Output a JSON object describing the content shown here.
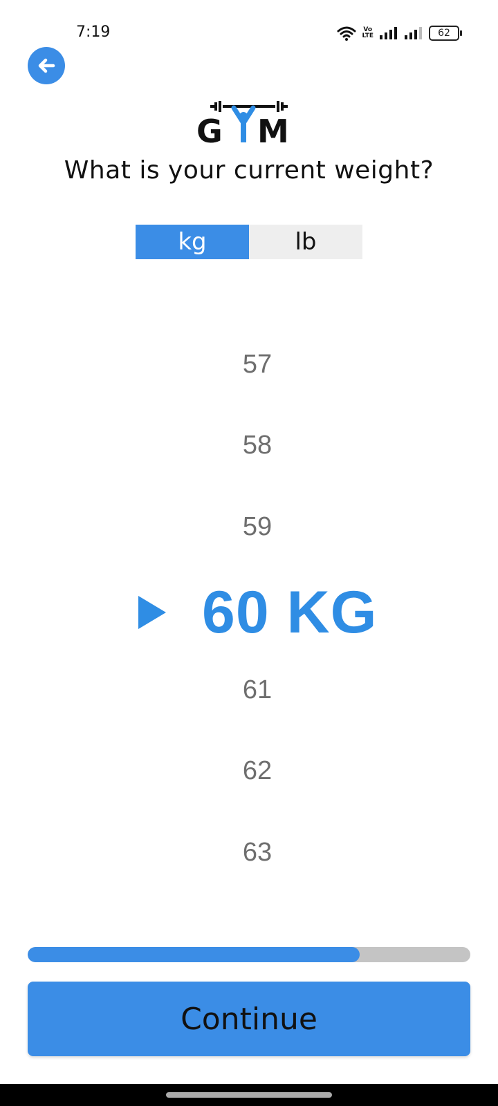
{
  "status_bar": {
    "time": "7:19",
    "volte_top": "Vo",
    "volte_bottom": "LTE",
    "battery": "62",
    "icons": [
      "wifi-icon",
      "volte-icon",
      "signal-icon",
      "signal-icon",
      "battery-icon"
    ]
  },
  "header": {
    "back_icon": "arrow-left-icon",
    "logo_text": "GYM",
    "question": "What is your current weight?"
  },
  "unit_toggle": {
    "options": [
      {
        "label": "kg",
        "selected": true
      },
      {
        "label": "lb",
        "selected": false
      }
    ]
  },
  "picker": {
    "items_above": [
      "57",
      "58",
      "59"
    ],
    "selected": "60 KG",
    "items_below": [
      "61",
      "62",
      "63"
    ]
  },
  "progress": {
    "fraction": 0.75
  },
  "actions": {
    "continue_label": "Continue"
  },
  "colors": {
    "accent": "#3b8de6",
    "selected_text": "#2f8de4",
    "muted_text": "#6e6e6e",
    "track": "#c4c4c4"
  }
}
